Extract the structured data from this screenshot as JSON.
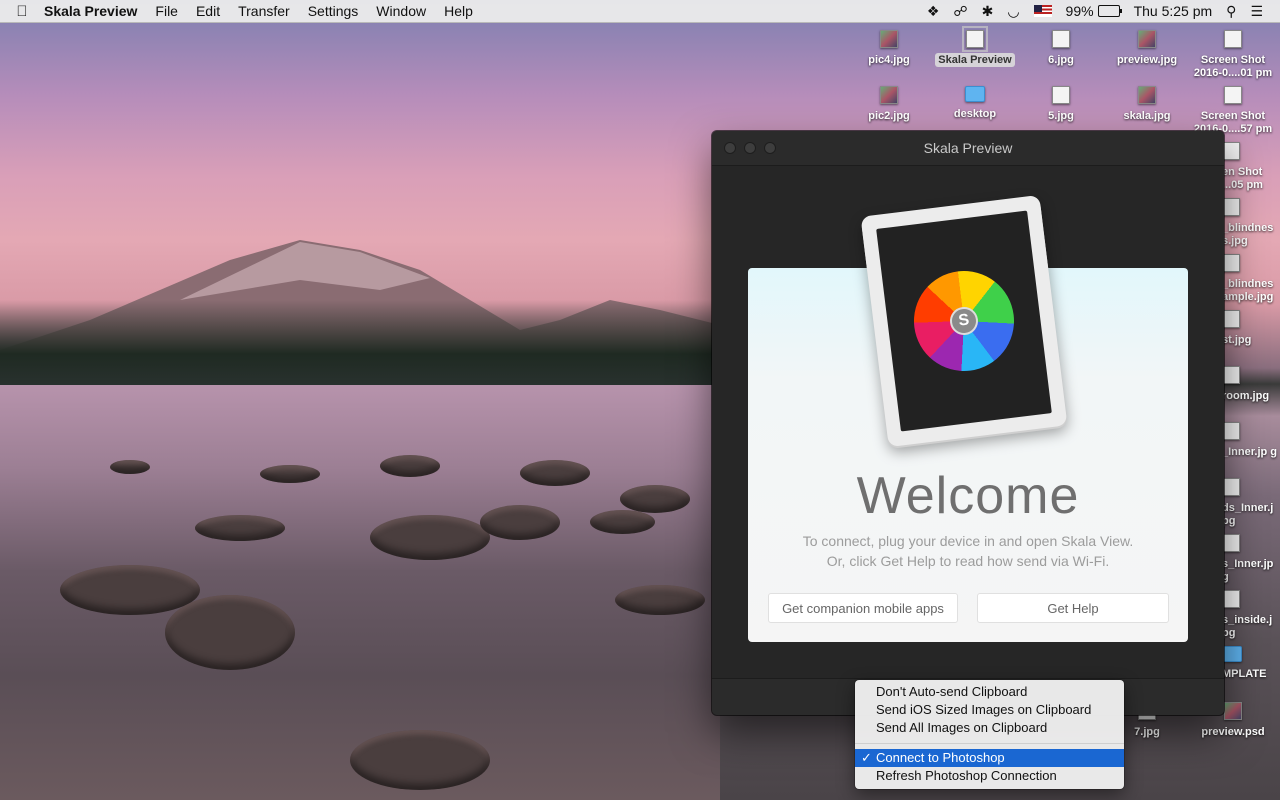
{
  "menubar": {
    "app_name": "Skala Preview",
    "menus": [
      "File",
      "Edit",
      "Transfer",
      "Settings",
      "Window",
      "Help"
    ],
    "battery": "99%",
    "clock": "Thu 5:25 pm"
  },
  "desktop_icons": [
    {
      "label": "pic4.jpg"
    },
    {
      "label": "Skala Preview"
    },
    {
      "label": "6.jpg"
    },
    {
      "label": "preview.jpg"
    },
    {
      "label": "Screen Shot 2016-0....01 pm"
    },
    {
      "label": "pic2.jpg"
    },
    {
      "label": "desktop"
    },
    {
      "label": "5.jpg"
    },
    {
      "label": "skala.jpg"
    },
    {
      "label": "Screen Shot 2016-0....57 pm"
    },
    {
      "label": "en Shot ...05 pm"
    },
    {
      "label": "_blindnes s.jpg"
    },
    {
      "label": "_blindnes ample.jpg"
    },
    {
      "label": "st.jpg"
    },
    {
      "label": "room.jpg"
    },
    {
      "label": "_Inner.jp g"
    },
    {
      "label": "ds_Inner.j pg"
    },
    {
      "label": "s_Inner.jp g"
    },
    {
      "label": "s_inside.j pg"
    },
    {
      "label": "MPLATE"
    },
    {
      "label": "7.jpg"
    },
    {
      "label": "preview.psd"
    }
  ],
  "window": {
    "title": "Skala Preview",
    "welcome": "Welcome",
    "line1": "To connect, plug your device in and open Skala View.",
    "line2": "Or, click Get Help to read how send via Wi-Fi.",
    "btn_apps": "Get companion mobile apps",
    "btn_help": "Get Help"
  },
  "context_menu": {
    "items": [
      "Don't Auto-send Clipboard",
      "Send iOS Sized Images on Clipboard",
      "Send All Images on Clipboard",
      "Connect to Photoshop",
      "Refresh Photoshop Connection"
    ],
    "checkmark": "✓"
  }
}
